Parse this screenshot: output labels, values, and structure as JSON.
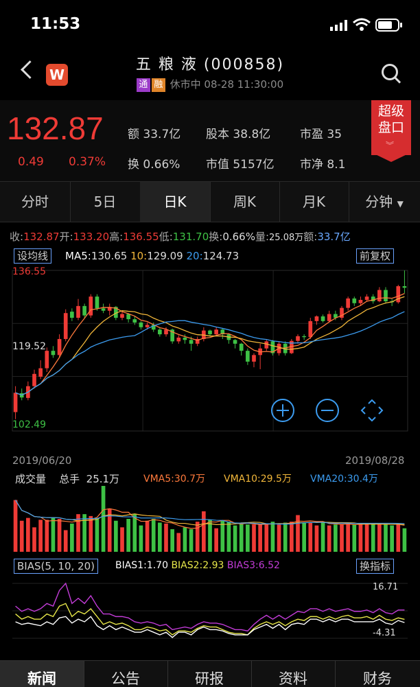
{
  "status": {
    "time": "11:53"
  },
  "header": {
    "title": "五 粮 液 (000858)",
    "tag1": "通",
    "tag2": "融",
    "status_text": "休市中 08-28 11:30:00",
    "logo_letter": "W"
  },
  "quote": {
    "price": "132.87",
    "change": "0.49",
    "change_pct": "0.37%",
    "amount_label": "额",
    "amount": "33.7亿",
    "shares_label": "股本",
    "shares": "38.8亿",
    "pe_label": "市盈",
    "pe": "35",
    "turnover_label": "换",
    "turnover": "0.66%",
    "mktcap_label": "市值",
    "mktcap": "5157亿",
    "pb_label": "市净",
    "pb": "8.1",
    "super_line1": "超级",
    "super_line2": "盘口"
  },
  "tabs": [
    "分时",
    "5日",
    "日K",
    "周K",
    "月K",
    "分钟"
  ],
  "active_tab": 2,
  "ohlc": {
    "close_label": "收:",
    "close": "132.87",
    "open_label": "开:",
    "open": "133.20",
    "high_label": "高:",
    "high": "136.55",
    "low_label": "低:",
    "low": "131.70",
    "turn_label": "换:",
    "turn": "0.66%",
    "vol_label": "量:",
    "vol": "25.08万",
    "amt_label": "额:",
    "amt": "33.7亿"
  },
  "ma": {
    "set_button": "设均线",
    "ma5_label": "MA5:",
    "ma5": "130.65",
    "ma10_label": "10:",
    "ma10": "129.09",
    "ma20_label": "20:",
    "ma20": "124.73",
    "adjust_button": "前复权"
  },
  "axis": {
    "high": "136.55",
    "mid": "119.52",
    "low": "102.49",
    "start_date": "2019/06/20",
    "end_date": "2019/08/28"
  },
  "volume": {
    "title": "成交量",
    "total_label": "总手",
    "total": "25.1万",
    "vma5": "VMA5:30.7万",
    "vma10": "VMA10:29.5万",
    "vma20": "VMA20:30.4万"
  },
  "bias": {
    "button": "BIAS(5, 10, 20)",
    "bias1": "BIAS1:1.70",
    "bias2": "BIAS2:2.93",
    "bias3": "BIAS3:6.52",
    "switch_button": "换指标",
    "max": "16.71",
    "min": "-4.31"
  },
  "bottom_nav": [
    "新闻",
    "公告",
    "研报",
    "资料",
    "财务"
  ],
  "colors": {
    "up": "#ef3b36",
    "down": "#3ec145",
    "ma5": "#ff7a3c",
    "ma10": "#f2b73a",
    "ma20": "#3c9cf0",
    "bias1": "#ffffff",
    "bias2": "#e8e84a",
    "bias3": "#c33cd8"
  },
  "chart_data": {
    "type": "candlestick",
    "x_range": [
      "2019/06/20",
      "2019/08/28"
    ],
    "ylim": [
      102.49,
      136.55
    ],
    "candles": [
      [
        106.5,
        110.6,
        105.0,
        112.0
      ],
      [
        110.5,
        109.6,
        109.0,
        111.5
      ],
      [
        109.5,
        112.0,
        109.0,
        113.0
      ],
      [
        112.0,
        114.6,
        111.5,
        115.5
      ],
      [
        114.0,
        115.8,
        113.5,
        117.5
      ],
      [
        115.8,
        119.5,
        115.0,
        120.2
      ],
      [
        119.5,
        118.6,
        118.0,
        120.5
      ],
      [
        118.6,
        122.0,
        118.0,
        123.0
      ],
      [
        122.0,
        127.5,
        121.5,
        128.3
      ],
      [
        127.8,
        126.5,
        125.8,
        128.5
      ],
      [
        126.5,
        129.0,
        126.0,
        130.5
      ],
      [
        129.0,
        127.0,
        126.5,
        129.5
      ],
      [
        127.0,
        131.0,
        126.5,
        131.5
      ],
      [
        131.0,
        128.5,
        128.0,
        131.5
      ],
      [
        128.5,
        128.0,
        127.5,
        129.5
      ],
      [
        128.0,
        128.8,
        127.0,
        129.5
      ],
      [
        128.8,
        126.5,
        126.0,
        129.0
      ],
      [
        126.5,
        127.3,
        126.0,
        127.8
      ],
      [
        127.3,
        126.2,
        125.5,
        127.5
      ],
      [
        126.2,
        125.5,
        125.0,
        126.8
      ],
      [
        125.5,
        124.5,
        124.0,
        125.8
      ],
      [
        124.5,
        125.0,
        124.0,
        125.5
      ],
      [
        125.0,
        124.0,
        123.5,
        125.5
      ],
      [
        124.0,
        123.0,
        122.5,
        124.3
      ],
      [
        123.0,
        124.0,
        122.5,
        124.5
      ],
      [
        124.0,
        121.5,
        121.0,
        124.2
      ],
      [
        121.5,
        122.3,
        121.0,
        122.8
      ],
      [
        122.3,
        121.8,
        121.0,
        123.0
      ],
      [
        121.8,
        121.0,
        119.5,
        122.5
      ],
      [
        121.0,
        122.0,
        120.5,
        122.5
      ],
      [
        122.0,
        123.8,
        121.5,
        124.5
      ],
      [
        123.8,
        123.0,
        122.5,
        124.0
      ],
      [
        123.0,
        124.0,
        122.8,
        124.5
      ],
      [
        124.0,
        123.0,
        122.0,
        124.2
      ],
      [
        123.0,
        121.8,
        121.0,
        123.2
      ],
      [
        121.8,
        121.0,
        120.0,
        122.0
      ],
      [
        121.0,
        119.5,
        118.5,
        121.2
      ],
      [
        119.5,
        117.2,
        116.5,
        120.0
      ],
      [
        117.2,
        118.6,
        116.0,
        119.0
      ],
      [
        118.6,
        120.0,
        115.6,
        121.0
      ],
      [
        120.0,
        121.5,
        119.5,
        122.0
      ],
      [
        121.5,
        119.0,
        118.5,
        121.8
      ],
      [
        119.0,
        121.0,
        118.5,
        121.5
      ],
      [
        121.0,
        119.0,
        118.5,
        121.5
      ],
      [
        119.0,
        121.6,
        118.8,
        122.0
      ],
      [
        121.6,
        122.6,
        121.0,
        123.0
      ],
      [
        122.6,
        122.4,
        121.8,
        123.0
      ],
      [
        122.4,
        125.8,
        122.0,
        126.5
      ],
      [
        125.8,
        126.8,
        125.0,
        127.0
      ],
      [
        126.8,
        125.8,
        125.5,
        127.2
      ],
      [
        125.8,
        127.3,
        125.5,
        128.0
      ],
      [
        127.3,
        126.5,
        126.0,
        128.0
      ],
      [
        126.5,
        128.6,
        126.0,
        129.0
      ],
      [
        128.6,
        130.6,
        128.0,
        131.0
      ],
      [
        130.6,
        129.6,
        129.0,
        131.0
      ],
      [
        129.6,
        130.3,
        129.0,
        131.0
      ],
      [
        130.3,
        131.0,
        130.0,
        131.5
      ],
      [
        131.0,
        130.0,
        129.5,
        131.5
      ],
      [
        130.0,
        132.4,
        129.8,
        133.0
      ],
      [
        132.4,
        130.0,
        129.5,
        133.0
      ],
      [
        130.0,
        129.8,
        129.0,
        130.5
      ],
      [
        129.8,
        133.2,
        129.5,
        133.5
      ],
      [
        133.2,
        132.87,
        131.7,
        136.55
      ]
    ],
    "volume_max": 70,
    "volumes": [
      55,
      33,
      36,
      26,
      34,
      34,
      36,
      35,
      23,
      30,
      40,
      40,
      38,
      35,
      70,
      46,
      33,
      26,
      35,
      40,
      28,
      33,
      35,
      31,
      30,
      24,
      20,
      26,
      24,
      32,
      43,
      34,
      25,
      33,
      32,
      28,
      30,
      29,
      29,
      29,
      29,
      32,
      29,
      31,
      32,
      39,
      31,
      31,
      28,
      32,
      28,
      29,
      29,
      30,
      29,
      29,
      30,
      30,
      29,
      29,
      28,
      30,
      25
    ],
    "volume_up": [
      true,
      true,
      true,
      true,
      true,
      true,
      false,
      true,
      true,
      false,
      true,
      false,
      true,
      false,
      false,
      true,
      false,
      true,
      false,
      false,
      false,
      true,
      false,
      false,
      true,
      false,
      true,
      false,
      false,
      true,
      true,
      false,
      true,
      false,
      false,
      false,
      false,
      false,
      true,
      true,
      true,
      false,
      true,
      false,
      true,
      true,
      false,
      true,
      true,
      false,
      true,
      false,
      true,
      true,
      false,
      true,
      true,
      false,
      true,
      false,
      false,
      true,
      false
    ],
    "bias_range": [
      -4.31,
      16.71
    ],
    "bias1": [
      2,
      1,
      1.5,
      1,
      0.5,
      2,
      1,
      3.5,
      4,
      1.5,
      3,
      2,
      4,
      0.5,
      -1,
      0.5,
      -1,
      0,
      -1,
      -2,
      -2,
      -1,
      -2,
      -3,
      -2,
      -4,
      -2,
      -2,
      -3,
      -1,
      0,
      -1,
      -1,
      -1.5,
      -2.5,
      -3,
      -3,
      -3,
      -1,
      0,
      1,
      -0.5,
      1,
      -1,
      1,
      1.5,
      1,
      3,
      3,
      2,
      3,
      2,
      3,
      3,
      2,
      2,
      2,
      2,
      3,
      1.5,
      1,
      2.5,
      1.7
    ],
    "bias2": [
      5,
      3,
      4,
      3,
      3,
      5,
      4,
      8,
      9,
      4,
      6,
      5,
      7,
      4,
      1,
      2,
      1,
      1.5,
      0.5,
      -1,
      -1,
      0,
      -0.5,
      -1.5,
      -1,
      -3,
      -1.5,
      -1.5,
      -2,
      -0.5,
      0.5,
      0,
      0,
      -1,
      -2,
      -2.5,
      -2.5,
      -3,
      -0.5,
      1,
      2,
      1,
      2,
      0.5,
      2,
      3,
      2.5,
      4,
      4,
      3,
      4,
      3,
      4,
      4.5,
      3.5,
      3.5,
      4,
      3,
      4.5,
      3,
      2.5,
      3.5,
      2.93
    ],
    "bias3": [
      8,
      6,
      7,
      6,
      7,
      9,
      8,
      14,
      16.71,
      9,
      11,
      9,
      12,
      8,
      5,
      5,
      4,
      4,
      3.5,
      2,
      1.5,
      2,
      1.5,
      0.5,
      1,
      -1,
      -0.5,
      0,
      -0.5,
      1,
      2,
      1.5,
      1.5,
      1,
      0,
      -1,
      -1,
      -1.5,
      1,
      3,
      4.5,
      3,
      4.5,
      3,
      4.5,
      6,
      5.5,
      7,
      7,
      6,
      7,
      6,
      6.5,
      7,
      6,
      6,
      6.5,
      5.5,
      7,
      5.5,
      5,
      6.5,
      6.52
    ]
  }
}
